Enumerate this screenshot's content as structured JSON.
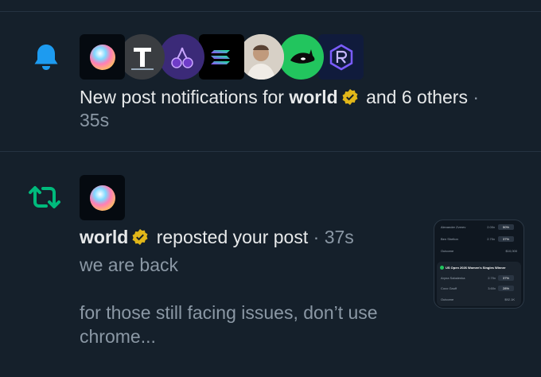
{
  "notification_1": {
    "text_prefix": "New post notifications for ",
    "account_name": "world",
    "text_suffix": " and 6 others",
    "separator": " · ",
    "time": "35s",
    "avatars": [
      "world-avatar",
      "t-logo-avatar",
      "cherry-avatar",
      "solana-avatar",
      "person-avatar",
      "orca-avatar",
      "raydium-avatar"
    ]
  },
  "notification_2": {
    "account_name": "world",
    "action_text": " reposted your post",
    "separator": " · ",
    "time": "37s",
    "post_line_1": "we are back",
    "post_line_2": "for those still facing issues, don’t use chrome..."
  },
  "thumbnail": {
    "row1_name": "Alexander Zverev",
    "row1_odds": "2.00x",
    "row1_pct": "50%",
    "row2_name": "Ben Shelton",
    "row2_odds": "2.70x",
    "row2_pct": "37%",
    "row3_left": "Outcome",
    "row3_right": "$10,000",
    "card_title": "US Open 2026 Women's Singles Winner",
    "c_row1_name": "Aryna Sabalenka",
    "c_row1_odds": "2.70x",
    "c_row1_pct": "37%",
    "c_row2_name": "Coco Gauff",
    "c_row2_odds": "3.60x",
    "c_row2_pct": "28%",
    "c_row3_left": "Outcome",
    "c_row3_right": "$92.1K"
  },
  "colors": {
    "background": "#15202b",
    "bell": "#1d9bf0",
    "repost": "#00ba7c",
    "verified": "#e2b719"
  }
}
